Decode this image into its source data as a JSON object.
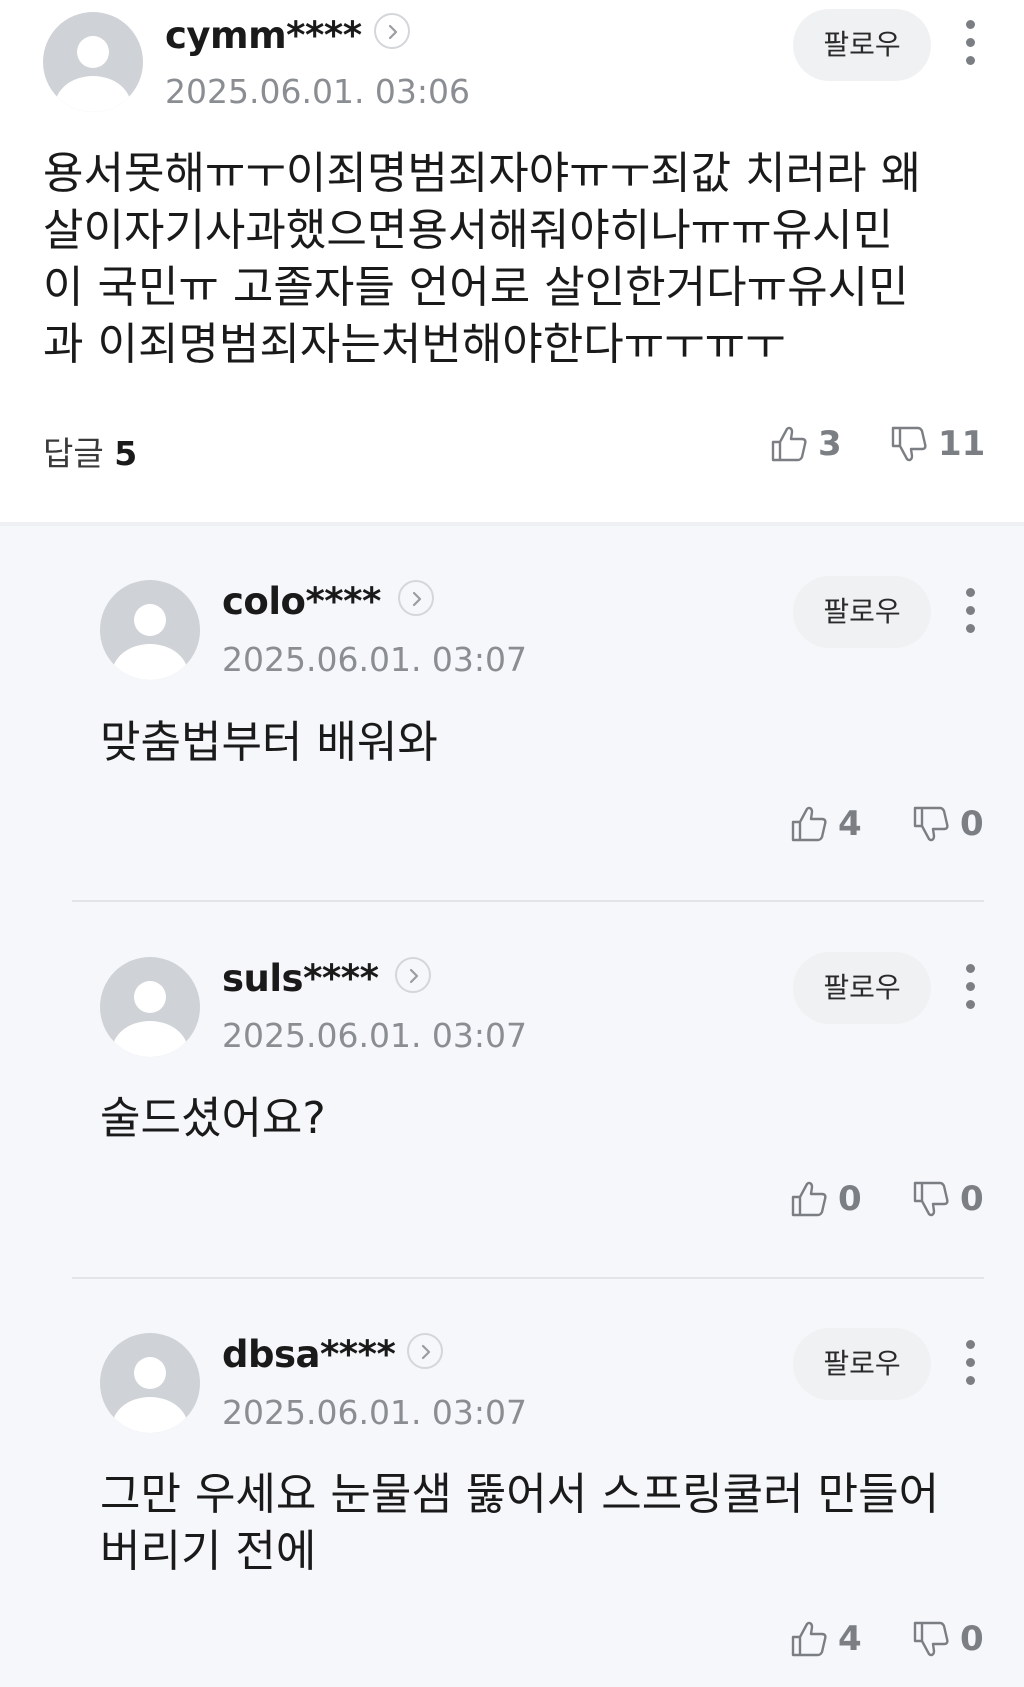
{
  "main": {
    "username": "cymm****",
    "timestamp": "2025.06.01. 03:06",
    "follow_label": "팔로우",
    "text_lines": [
      "용서못해ㅠㅜ이죄명범죄자야ㅠㅜ죄값 치러라 왜",
      "살이자기사과했으면용서해줘야히나ㅠㅠ유시민",
      "이 국민ㅠ 고졸자들 언어로 살인한거다ㅠ유시민",
      "과 이죄명범죄자는처번해야한다ㅠㅜㅠㅜ"
    ],
    "reply_label": "답글",
    "reply_count": "5",
    "likes": "3",
    "dislikes": "11"
  },
  "replies": [
    {
      "username": "colo****",
      "timestamp": "2025.06.01. 03:07",
      "follow_label": "팔로우",
      "text_lines": [
        "맞춤법부터 배워와"
      ],
      "likes": "4",
      "dislikes": "0"
    },
    {
      "username": "suls****",
      "timestamp": "2025.06.01. 03:07",
      "follow_label": "팔로우",
      "text_lines": [
        "술드셨어요?"
      ],
      "likes": "0",
      "dislikes": "0"
    },
    {
      "username": "dbsa****",
      "timestamp": "2025.06.01. 03:07",
      "follow_label": "팔로우",
      "text_lines": [
        "그만 우세요 눈물샘 뚫어서 스프링쿨러 만들어",
        "버리기 전에"
      ],
      "likes": "4",
      "dislikes": "0"
    }
  ],
  "icons": {
    "avatar": "default-user-avatar-icon",
    "chevron": "chevron-right-icon",
    "more": "more-vertical-icon",
    "like": "thumbs-up-icon",
    "dislike": "thumbs-down-icon"
  },
  "colors": {
    "reply_background": "#f6f7fa",
    "avatar": "#cfd2d6",
    "muted_text": "#8a8d92",
    "follow_button": "#f0f1f3"
  }
}
